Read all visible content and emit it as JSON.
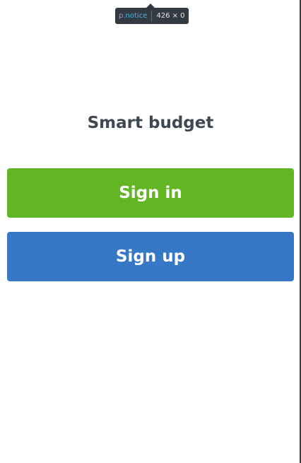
{
  "devtools_tooltip": {
    "tag": "p",
    "class_name": ".notice",
    "dimensions": "426 × 0"
  },
  "app": {
    "title": "Smart budget"
  },
  "actions": {
    "sign_in_label": "Sign in",
    "sign_up_label": "Sign up"
  },
  "colors": {
    "sign_in_bg": "#62b624",
    "sign_up_bg": "#3678c5",
    "title_text": "#3e4852"
  }
}
